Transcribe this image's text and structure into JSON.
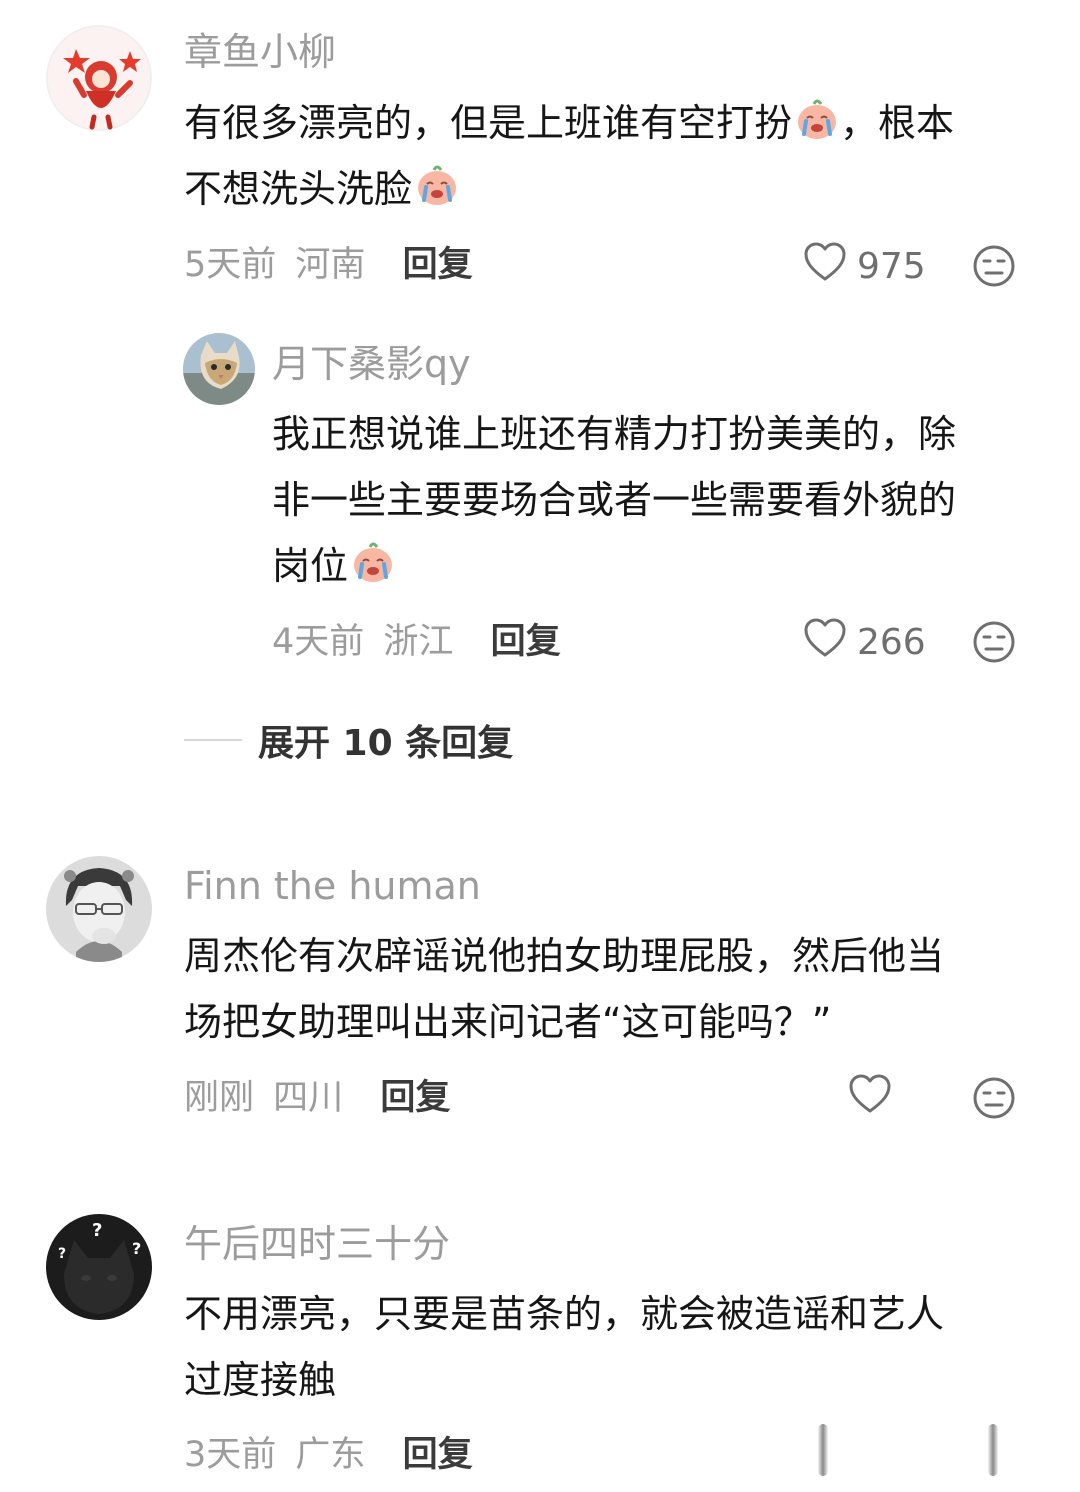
{
  "comments": [
    {
      "username": "章鱼小柳",
      "lines": [
        "有很多漂亮的，但是上班谁有空打扮",
        "，根本",
        "不想洗头洗脸"
      ],
      "time": "5天前",
      "location": "河南",
      "reply_label": "回复",
      "likes": "975"
    },
    {
      "username": "月下桑影qy",
      "lines": [
        "我正想说谁上班还有精力打扮美美的，除",
        "非一些主要要场合或者一些需要看外貌的",
        "岗位"
      ],
      "time": "4天前",
      "location": "浙江",
      "reply_label": "回复",
      "likes": "266"
    },
    {
      "username": "Finn the human",
      "lines": [
        "周杰伦有次辟谣说他拍女助理屁股，然后他当",
        "场把女助理叫出来问记者“这可能吗？”"
      ],
      "time": "刚刚",
      "location": "四川",
      "reply_label": "回复",
      "likes": ""
    },
    {
      "username": "午后四时三十分",
      "lines": [
        "不用漂亮，只要是苗条的，就会被造谣和艺人",
        "过度接触"
      ],
      "time": "3天前",
      "location": "广东",
      "reply_label": "回复",
      "likes": ""
    }
  ],
  "expand_replies": "展开 10 条回复",
  "icons": {
    "like": "heart-outline-icon",
    "dislike": "meh-face-icon",
    "emoji": "crying-peach-emoji"
  },
  "colors": {
    "username": "#9c9c9c",
    "text": "#161616",
    "reply": "#3b3b3b"
  }
}
